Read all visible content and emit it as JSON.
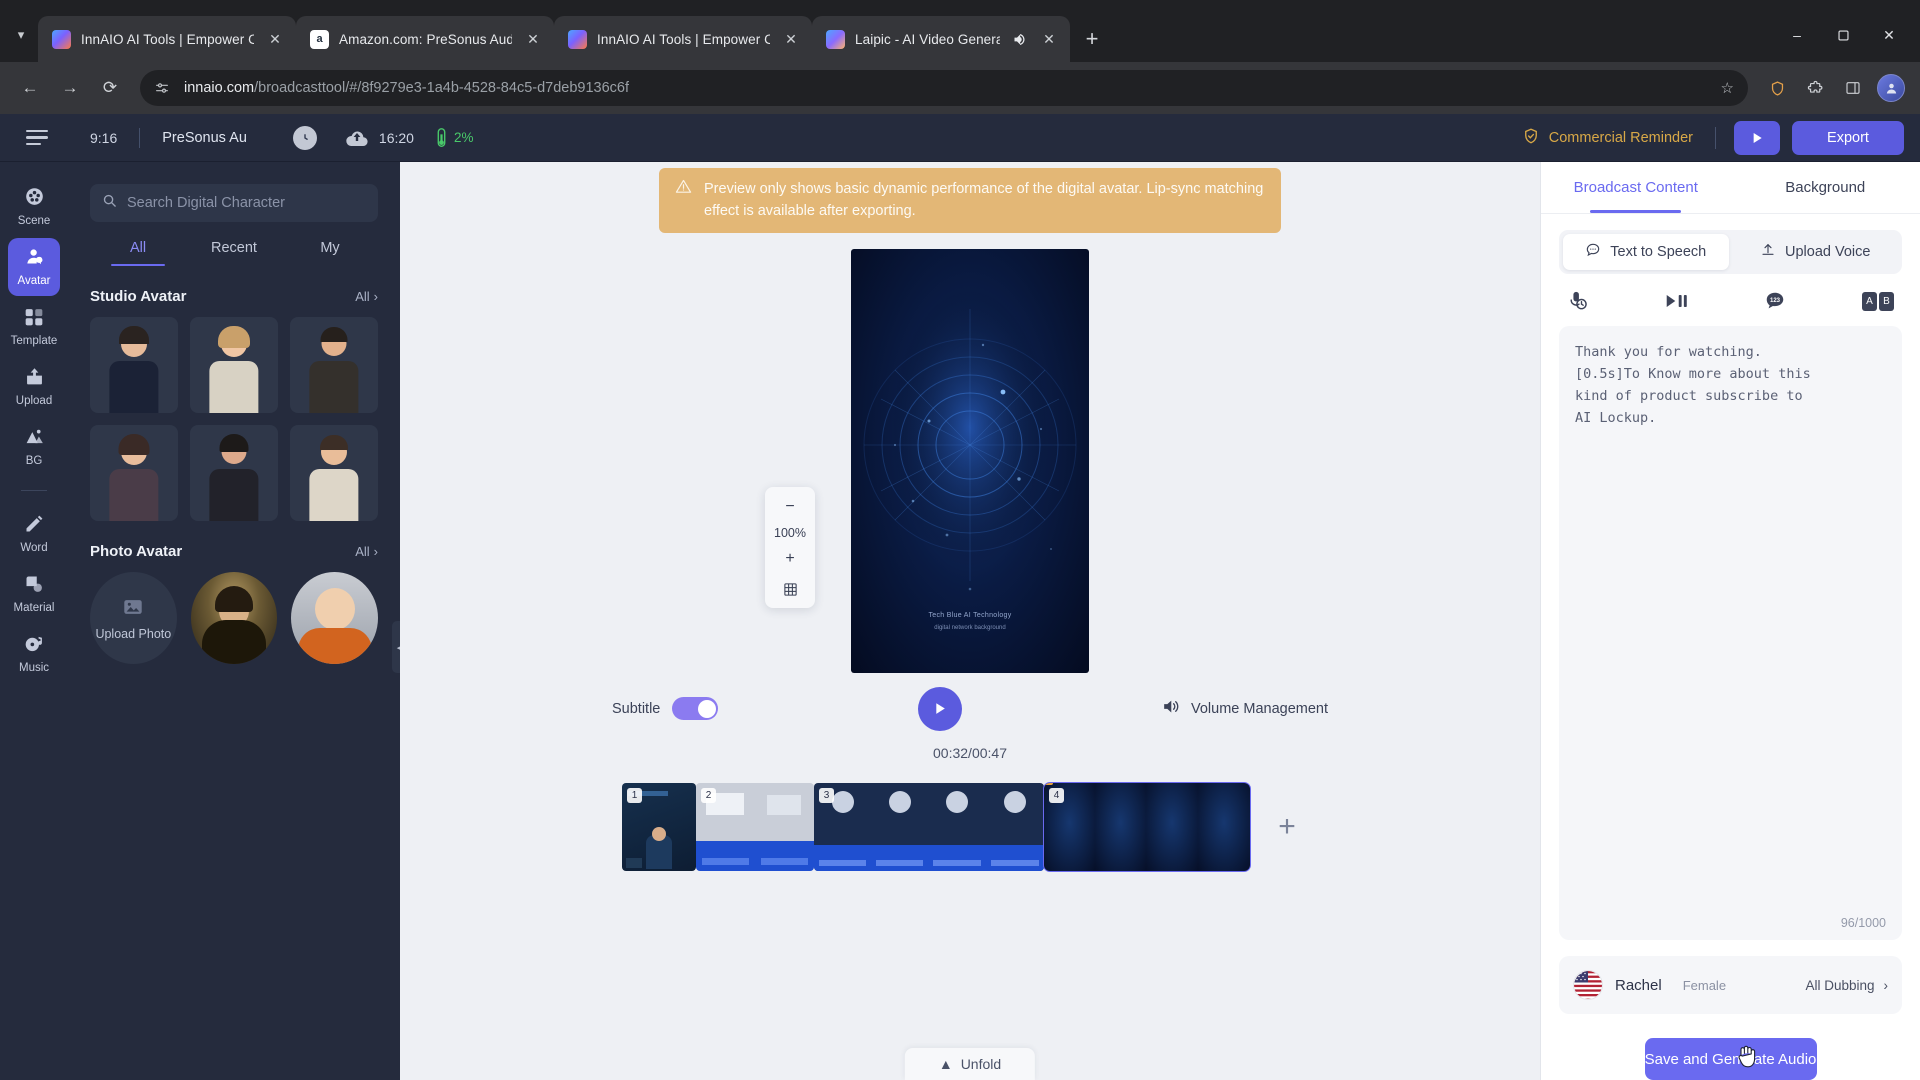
{
  "browser": {
    "tabs": [
      {
        "title": "InnAIO AI Tools | Empower Con",
        "favicon": "innaio-icon",
        "active": false,
        "audio": false
      },
      {
        "title": "Amazon.com: PreSonus AudioB",
        "favicon": "amazon-icon",
        "active": false,
        "audio": false
      },
      {
        "title": "InnAIO AI Tools | Empower Con",
        "favicon": "innaio-icon",
        "active": true,
        "audio": false
      },
      {
        "title": "Laipic - AI Video Generator",
        "favicon": "laipic-icon",
        "active": false,
        "audio": true
      }
    ],
    "new_tab_label": "+",
    "window": {
      "minimize": "–",
      "maximize": "❐",
      "close": "✕"
    },
    "url_domain": "innaio.com",
    "url_path": "/broadcasttool/#/8f9279e3-1a4b-4528-84c5-d7deb9136c6f"
  },
  "app_header": {
    "aspect_ratio": "9:16",
    "project_name": "PreSonus Au",
    "duration": "16:20",
    "battery": "2%",
    "commercial_reminder": "Commercial Reminder",
    "export_label": "Export"
  },
  "rail": {
    "items": [
      {
        "label": "Scene",
        "icon": "film-reel-icon",
        "active": false
      },
      {
        "label": "Avatar",
        "icon": "avatar-person-icon",
        "active": true
      },
      {
        "label": "Template",
        "icon": "grid-squares-icon",
        "active": false
      },
      {
        "label": "Upload",
        "icon": "upload-tray-icon",
        "active": false
      },
      {
        "label": "BG",
        "icon": "mountain-image-icon",
        "active": false
      },
      {
        "label": "Word",
        "icon": "pencil-icon",
        "active": false
      },
      {
        "label": "Material",
        "icon": "shapes-icon",
        "active": false
      },
      {
        "label": "Music",
        "icon": "music-note-icon",
        "active": false
      }
    ]
  },
  "library": {
    "search_placeholder": "Search Digital Character",
    "search_value": "",
    "tabs": [
      {
        "label": "All",
        "active": true
      },
      {
        "label": "Recent",
        "active": false
      },
      {
        "label": "My",
        "active": false
      }
    ],
    "studio": {
      "title": "Studio Avatar",
      "all_label": "All",
      "cards": [
        {
          "suit": "#1b2236",
          "skin": "#e6bb9a",
          "hair": "#2a2320"
        },
        {
          "suit": "#d8d2c4",
          "skin": "#f0c6a4",
          "hair": "#c9a06a"
        },
        {
          "suit": "#34302c",
          "skin": "#e3b18c",
          "hair": "#26201c"
        },
        {
          "suit": "#4a3c48",
          "skin": "#e8bd9c",
          "hair": "#3a2a26"
        },
        {
          "suit": "#22222a",
          "skin": "#dda98b",
          "hair": "#1d1a19"
        },
        {
          "suit": "#ddd6c8",
          "skin": "#e9bd99",
          "hair": "#3c2e26"
        }
      ]
    },
    "photo": {
      "title": "Photo Avatar",
      "all_label": "All",
      "upload_label": "Upload Photo",
      "items": [
        {
          "name": "mona-lisa-avatar"
        },
        {
          "name": "child-monk-avatar"
        }
      ]
    }
  },
  "stage": {
    "warning": "Preview only shows basic dynamic performance of the digital avatar. Lip-sync matching effect is available after exporting.",
    "zoom_value": "100%",
    "zoom_out": "−",
    "zoom_in": "+",
    "subtitle_label": "Subtitle",
    "subtitle_on": true,
    "volume_label": "Volume Management",
    "timecode": "00:32/00:47",
    "canvas_caption": "Tech Blue AI Technology",
    "canvas_caption2": "digital network background",
    "unfold_label": "Unfold",
    "clips": [
      {
        "index": "1",
        "selected": false
      },
      {
        "index": "2",
        "selected": false
      },
      {
        "index": "3",
        "selected": false
      },
      {
        "index": "4",
        "selected": true
      }
    ]
  },
  "right_panel": {
    "tabs": [
      {
        "label": "Broadcast Content",
        "active": true
      },
      {
        "label": "Background",
        "active": false
      }
    ],
    "mode_tabs": [
      {
        "label": "Text to Speech",
        "icon": "speech-bubble-icon",
        "active": true
      },
      {
        "label": "Upload Voice",
        "icon": "upload-arrow-icon",
        "active": false
      }
    ],
    "tools": [
      {
        "name": "mic-speed-icon"
      },
      {
        "name": "play-pause-icon"
      },
      {
        "name": "number-bubble-icon"
      },
      {
        "name": "ab-compare-icon",
        "a": "A",
        "b": "B"
      }
    ],
    "script": "Thank you for watching.\n[0.5s]To Know more about this\nkind of product subscribe to\nAI Lockup.",
    "char_count": "96/1000",
    "voice": {
      "name": "Rachel",
      "gender": "Female",
      "dubbing_label": "All Dubbing",
      "flag": "us-flag-icon"
    },
    "save_label": "Save and Generate Audio"
  }
}
